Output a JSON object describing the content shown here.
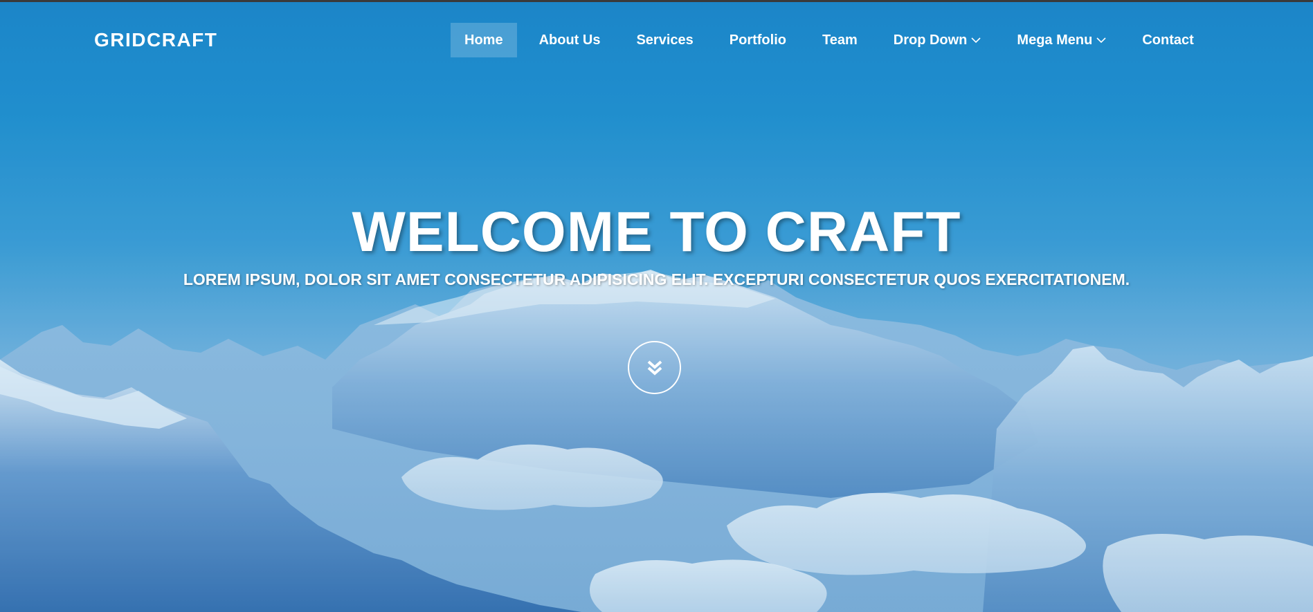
{
  "navbar": {
    "brand": "GRIDCRAFT",
    "items": [
      {
        "label": "Home",
        "active": true
      },
      {
        "label": "About Us"
      },
      {
        "label": "Services"
      },
      {
        "label": "Portfolio"
      },
      {
        "label": "Team"
      },
      {
        "label": "Drop Down",
        "icon": "chevron-down-icon"
      },
      {
        "label": "Mega Menu",
        "icon": "chevron-down-icon"
      },
      {
        "label": "Contact"
      }
    ]
  },
  "hero": {
    "title": "WELCOME TO CRAFT",
    "subtitle": "LOREM IPSUM, DOLOR SIT AMET CONSECTETUR ADIPISICING ELIT. EXCEPTURI CONSECTETUR QUOS EXERCITATIONEM.",
    "scroll_icon": "double-chevron-down-icon",
    "background_image": "snowy-mountain-range"
  },
  "colors": {
    "sky_top": "#1c86c9",
    "nav_text": "#ffffff",
    "active_nav_bg": "rgba(255,255,255,0.2)"
  }
}
